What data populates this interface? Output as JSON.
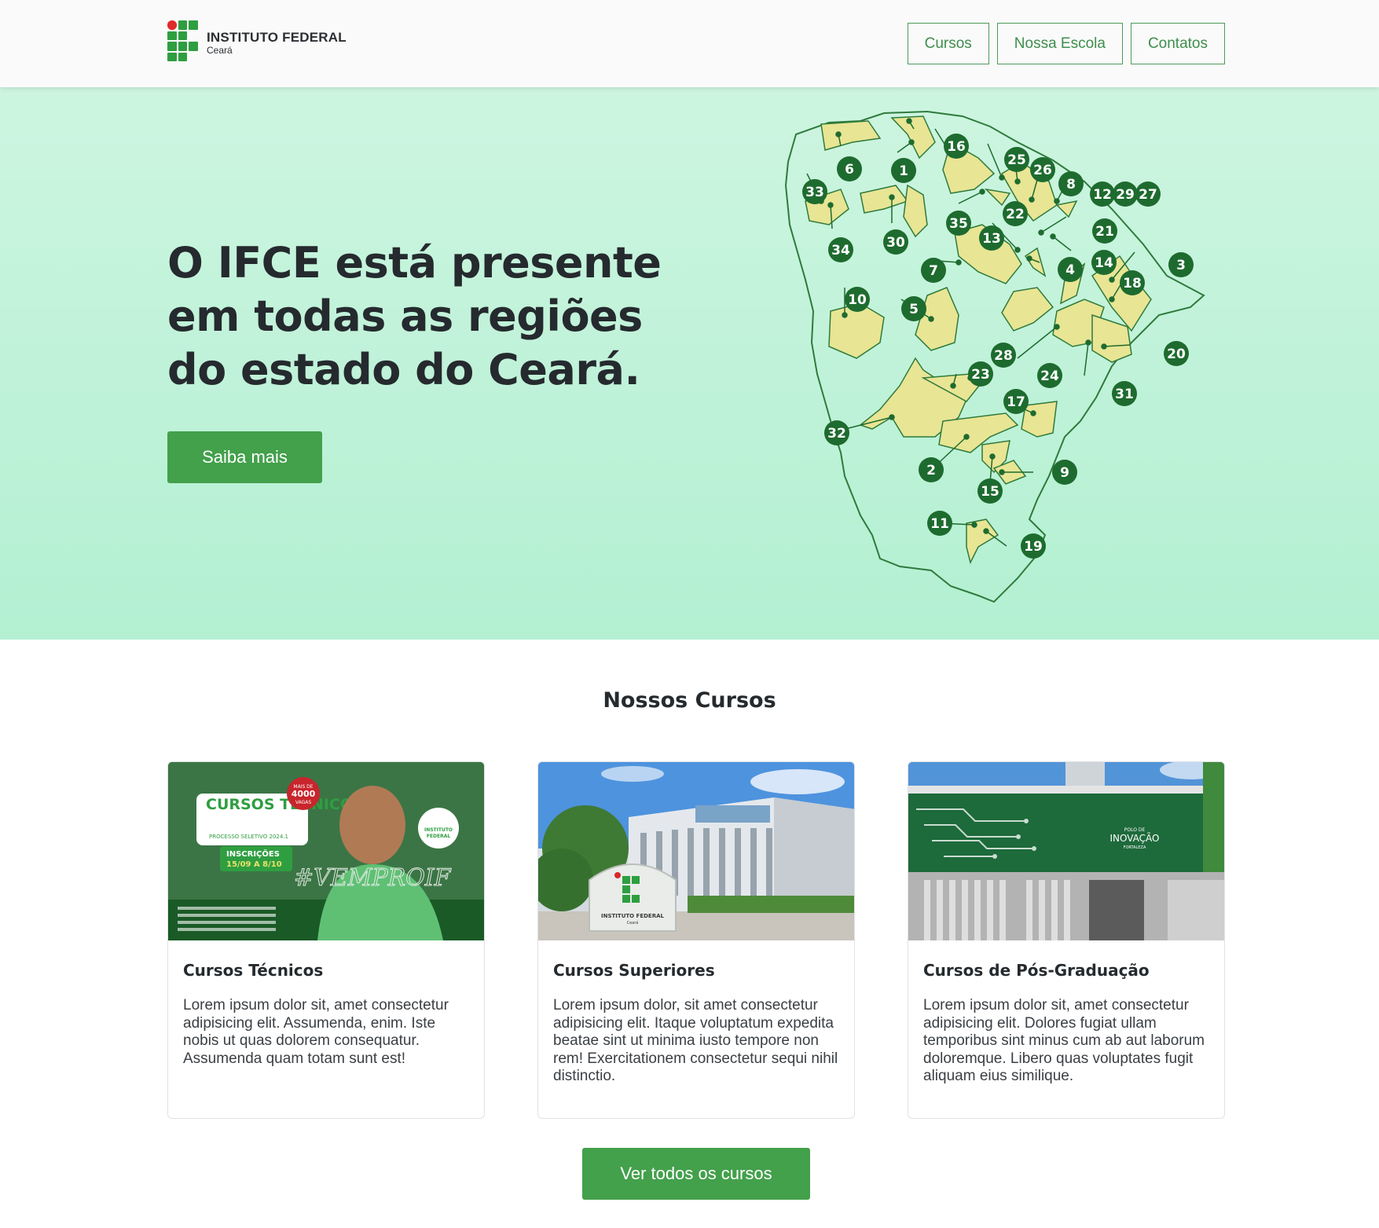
{
  "header": {
    "logo": {
      "title": "INSTITUTO FEDERAL",
      "subtitle": "Ceará"
    },
    "nav": [
      "Cursos",
      "Nossa Escola",
      "Contatos"
    ]
  },
  "hero": {
    "title": "O IFCE está presente em todas as regiões do estado do Ceará.",
    "button": "Saiba mais",
    "map_markers": [
      "1",
      "2",
      "3",
      "4",
      "5",
      "6",
      "7",
      "8",
      "9",
      "10",
      "11",
      "12",
      "13",
      "14",
      "15",
      "16",
      "17",
      "18",
      "19",
      "20",
      "21",
      "22",
      "23",
      "24",
      "25",
      "26",
      "27",
      "28",
      "29",
      "30",
      "31",
      "32",
      "33",
      "34",
      "35"
    ],
    "colors": {
      "marker": "#1e6b2f",
      "region": "#e8e594",
      "outline": "#2f7a3c"
    }
  },
  "courses": {
    "title": "Nossos Cursos",
    "cards": [
      {
        "title": "Cursos Técnicos",
        "text": "Lorem ipsum dolor sit, amet consectetur adipisicing elit. Assumenda, enim. Iste nobis ut quas dolorem consequatur. Assumenda quam totam sunt est!",
        "image": {
          "heading": "CURSOS TÉCNICOS",
          "subheading": "PROCESSO SELETIVO 2024.1",
          "badge_top": "MAIS DE",
          "badge_number": "4000",
          "badge_bottom": "VAGAS",
          "registration_label": "INSCRIÇÕES",
          "registration_dates": "15/09 A 8/10",
          "hashtag": "#VEMPROIF",
          "seal_line1": "INSTITUTO",
          "seal_line2": "FEDERAL"
        }
      },
      {
        "title": "Cursos Superiores",
        "text": "Lorem ipsum dolor, sit amet consectetur adipisicing elit. Itaque voluptatum expedita beatae sint ut minima iusto tempore non rem! Exercitationem consectetur sequi nihil distinctio.",
        "image": {
          "sign": "INSTITUTO FEDERAL",
          "sign_sub": "Ceará"
        }
      },
      {
        "title": "Cursos de Pós-Graduação",
        "text": "Lorem ipsum dolor sit, amet consectetur adipisicing elit. Dolores fugiat ullam temporibus sint minus cum ab aut laborum doloremque. Libero quas voluptates fugit aliquam eius similique.",
        "image": {
          "sign_small": "POLO DE",
          "sign": "INOVAÇÃO",
          "sign_sub": "FORTALEZA"
        }
      }
    ],
    "button": "Ver todos os cursos"
  }
}
